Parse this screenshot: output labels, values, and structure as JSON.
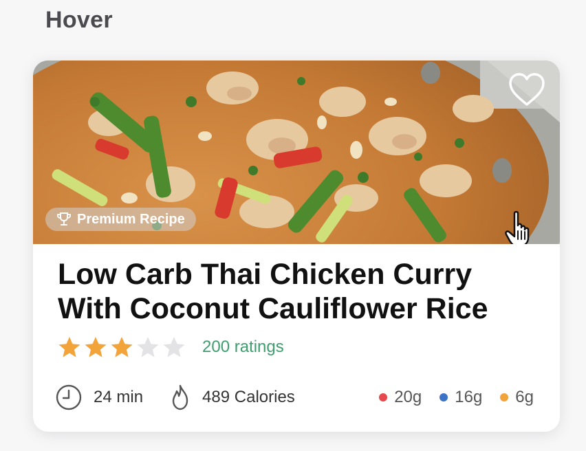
{
  "state_label": "Hover",
  "card": {
    "badge": {
      "label": "Premium Recipe",
      "icon": "trophy-icon"
    },
    "favorite_icon": "heart-outline-icon",
    "title": "Low Carb Thai Chicken Curry With Coconut Cauliflower Rice",
    "rating": {
      "stars": 3,
      "max": 5,
      "count_label": "200 ratings"
    },
    "time": {
      "icon": "clock-icon",
      "label": "24 min"
    },
    "calories": {
      "icon": "flame-icon",
      "label": "489 Calories"
    },
    "macros": [
      {
        "value": "20g",
        "color": "#e5484d"
      },
      {
        "value": "16g",
        "color": "#3b73c6"
      },
      {
        "value": "6g",
        "color": "#f2a33a"
      }
    ]
  },
  "colors": {
    "star_filled": "#f2a33a",
    "star_empty": "#e3e3e6",
    "ratings_text": "#3f9d6f"
  }
}
